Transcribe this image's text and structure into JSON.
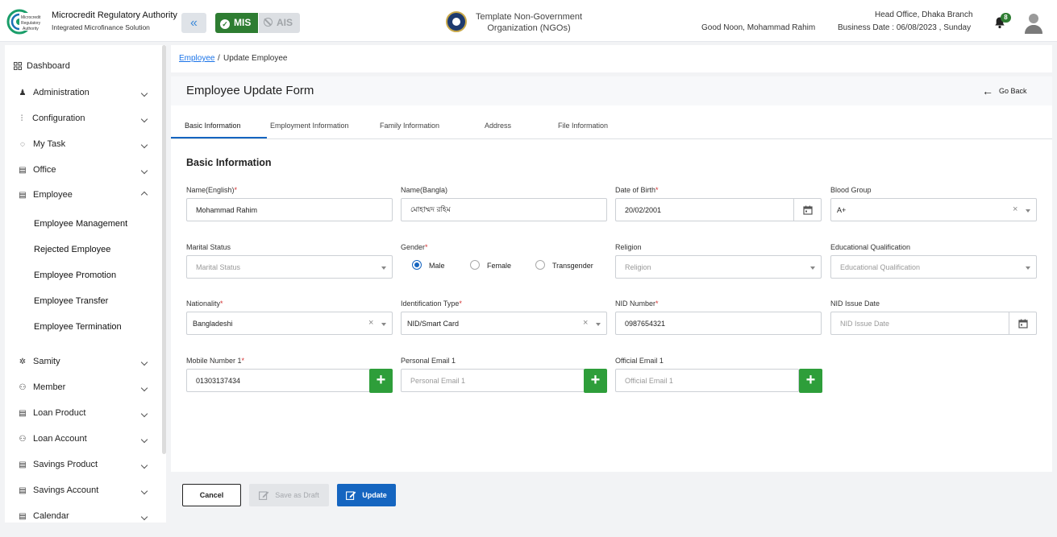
{
  "header": {
    "brand_title": "Microcredit Regulatory Authority",
    "brand_subtitle": "Integrated Microfinance Solution",
    "logo_text": "Microcredit Regulatory Authority",
    "mis_label": "MIS",
    "ais_label": "AIS",
    "org_line1": "Template Non-Government",
    "org_line2": "Organization (NGOs)",
    "greeting": "Good Noon, Mohammad Rahim",
    "branch": "Head Office, Dhaka Branch",
    "business_date": "Business Date : 06/08/2023 , Sunday",
    "notification_count": "8"
  },
  "sidebar": {
    "dashboard": "Dashboard",
    "items": [
      {
        "label": "Administration",
        "icon": "admin-icon"
      },
      {
        "label": "Configuration",
        "icon": "sliders-icon"
      },
      {
        "label": "My Task",
        "icon": "task-icon"
      },
      {
        "label": "Office",
        "icon": "office-icon"
      },
      {
        "label": "Employee",
        "icon": "employee-icon"
      },
      {
        "label": "Samity",
        "icon": "samity-icon"
      },
      {
        "label": "Member",
        "icon": "member-icon"
      },
      {
        "label": "Loan Product",
        "icon": "loan-product-icon"
      },
      {
        "label": "Loan Account",
        "icon": "loan-account-icon"
      },
      {
        "label": "Savings Product",
        "icon": "savings-product-icon"
      },
      {
        "label": "Savings Account",
        "icon": "savings-account-icon"
      },
      {
        "label": "Calendar",
        "icon": "calendar-icon"
      }
    ],
    "employee_sub": [
      "Employee Management",
      "Rejected Employee",
      "Employee Promotion",
      "Employee Transfer",
      "Employee Termination"
    ]
  },
  "breadcrumb": {
    "parent": "Employee",
    "separator": "/",
    "current": "Update Employee"
  },
  "form": {
    "title": "Employee Update Form",
    "go_back": "Go Back",
    "tabs": [
      "Basic Information",
      "Employment Information",
      "Family Information",
      "Address",
      "File Information"
    ],
    "section_title": "Basic Information",
    "name_en_label": "Name(English)",
    "name_en_value": "Mohammad Rahim",
    "name_bn_label": "Name(Bangla)",
    "name_bn_value": "মোহাম্মদ রহিম",
    "dob_label": "Date of Birth",
    "dob_value": "20/02/2001",
    "blood_label": "Blood Group",
    "blood_value": "A+",
    "marital_label": "Marital Status",
    "marital_placeholder": "Marital Status",
    "gender_label": "Gender",
    "gender_options": [
      "Male",
      "Female",
      "Transgender"
    ],
    "gender_selected": "Male",
    "religion_label": "Religion",
    "religion_placeholder": "Religion",
    "edu_label": "Educational Qualification",
    "edu_placeholder": "Educational Qualification",
    "nationality_label": "Nationality",
    "nationality_value": "Bangladeshi",
    "idtype_label": "Identification Type",
    "idtype_value": "NID/Smart Card",
    "nid_label": "NID Number",
    "nid_value": "0987654321",
    "nid_issue_label": "NID Issue Date",
    "nid_issue_placeholder": "NID Issue Date",
    "mobile_label": "Mobile Number 1",
    "mobile_value": "01303137434",
    "pemail_label": "Personal Email 1",
    "pemail_placeholder": "Personal Email 1",
    "oemail_label": "Official Email 1",
    "oemail_placeholder": "Official Email 1",
    "required_mark": "*",
    "clear_mark": "×",
    "add_mark": "+"
  },
  "actions": {
    "cancel": "Cancel",
    "draft": "Save as Draft",
    "update": "Update"
  },
  "colors": {
    "primary": "#1565c0",
    "success": "#2e7d32",
    "add": "#2e9e3a",
    "required": "#d32f2f"
  }
}
